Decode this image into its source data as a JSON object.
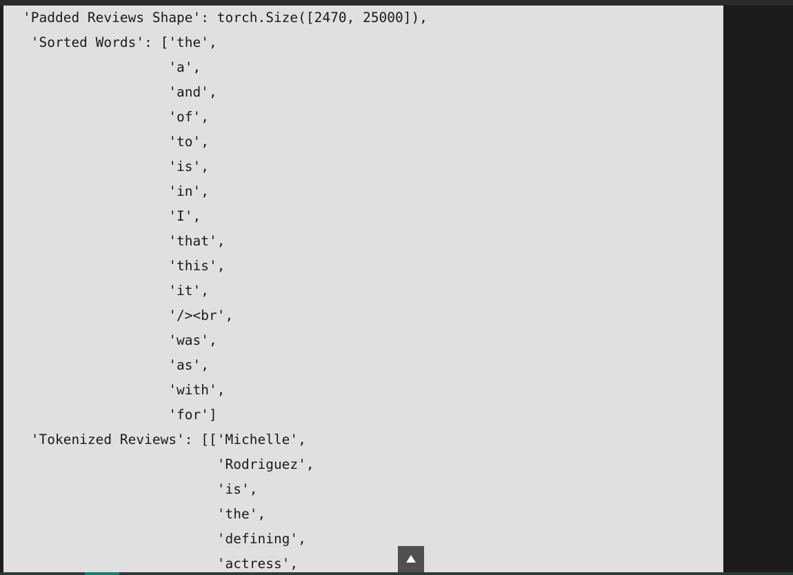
{
  "output": {
    "lines": [
      "'Padded Reviews Shape': torch.Size([2470, 25000]),",
      " 'Sorted Words': ['the',",
      "                  'a',",
      "                  'and',",
      "                  'of',",
      "                  'to',",
      "                  'is',",
      "                  'in',",
      "                  'I',",
      "                  'that',",
      "                  'this',",
      "                  'it',",
      "                  '/><br',",
      "                  'was',",
      "                  'as',",
      "                  'with',",
      "                  'for']",
      " 'Tokenized Reviews': [['Michelle',",
      "                        'Rodriguez',",
      "                        'is',",
      "                        'the',",
      "                        'defining',",
      "                        'actress',"
    ]
  },
  "scroll_to_top": {
    "icon": "arrow-up-icon"
  }
}
